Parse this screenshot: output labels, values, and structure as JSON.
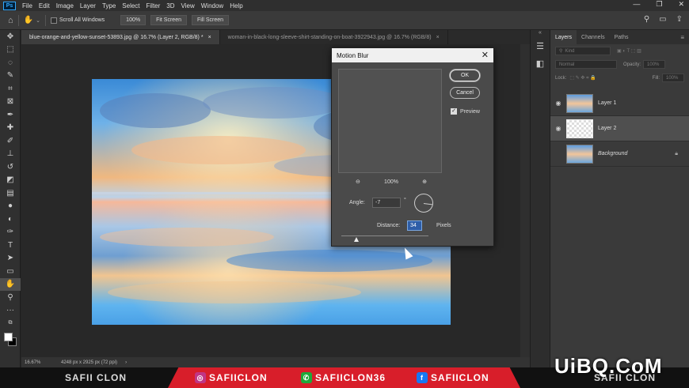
{
  "menubar": {
    "logo": "Ps",
    "items": [
      "File",
      "Edit",
      "Image",
      "Layer",
      "Type",
      "Select",
      "Filter",
      "3D",
      "View",
      "Window",
      "Help"
    ],
    "window_buttons": [
      "—",
      "❐",
      "✕"
    ]
  },
  "options": {
    "scroll_all_windows": "Scroll All Windows",
    "zoom_value": "100%",
    "fit_screen": "Fit Screen",
    "fill_screen": "Fill Screen"
  },
  "tabs": [
    {
      "label": "blue-orange-and-yellow-sunset-53893.jpg @ 16.7% (Layer 2, RGB/8) *",
      "close": "×"
    },
    {
      "label": "woman-in-black-long-sleeve-shirt-standing-on-boat-3922943.jpg @ 16.7% (RGB/8)",
      "close": "×"
    }
  ],
  "status": {
    "zoom": "16.67%",
    "doc_size": "4248 px x 2925 px (72 ppi)"
  },
  "layers_panel": {
    "tabs": [
      "Layers",
      "Channels",
      "Paths"
    ],
    "kind_placeholder": "Kind",
    "blend_mode": "Normal",
    "opacity_label": "Opacity:",
    "opacity_value": "100%",
    "lock_label": "Lock:",
    "fill_label": "Fill:",
    "fill_value": "100%",
    "layers": [
      {
        "name": "Layer 1"
      },
      {
        "name": "Layer 2"
      },
      {
        "name": "Background"
      }
    ]
  },
  "dialog": {
    "title": "Motion Blur",
    "ok": "OK",
    "cancel": "Cancel",
    "preview_label": "Preview",
    "zoom_value": "100%",
    "angle_label": "Angle:",
    "angle_value": "-7",
    "degree_symbol": "°",
    "distance_label": "Distance:",
    "distance_value": "34",
    "distance_unit": "Pixels",
    "distance_slider_fraction": 0.17
  },
  "banner": {
    "left_name": "SAFII CLON",
    "instagram": "SAFIICLON",
    "phone": "SAFIICLON36",
    "facebook": "SAFIICLON",
    "right_name": "SAFII CLON"
  },
  "watermark": "UiBQ.CoM",
  "colors": {
    "accent_blue": "#31a8ff",
    "banner_red": "#d81e2a",
    "instagram": "#c13584",
    "phone_green": "#1fa83b",
    "facebook": "#1877f2"
  }
}
